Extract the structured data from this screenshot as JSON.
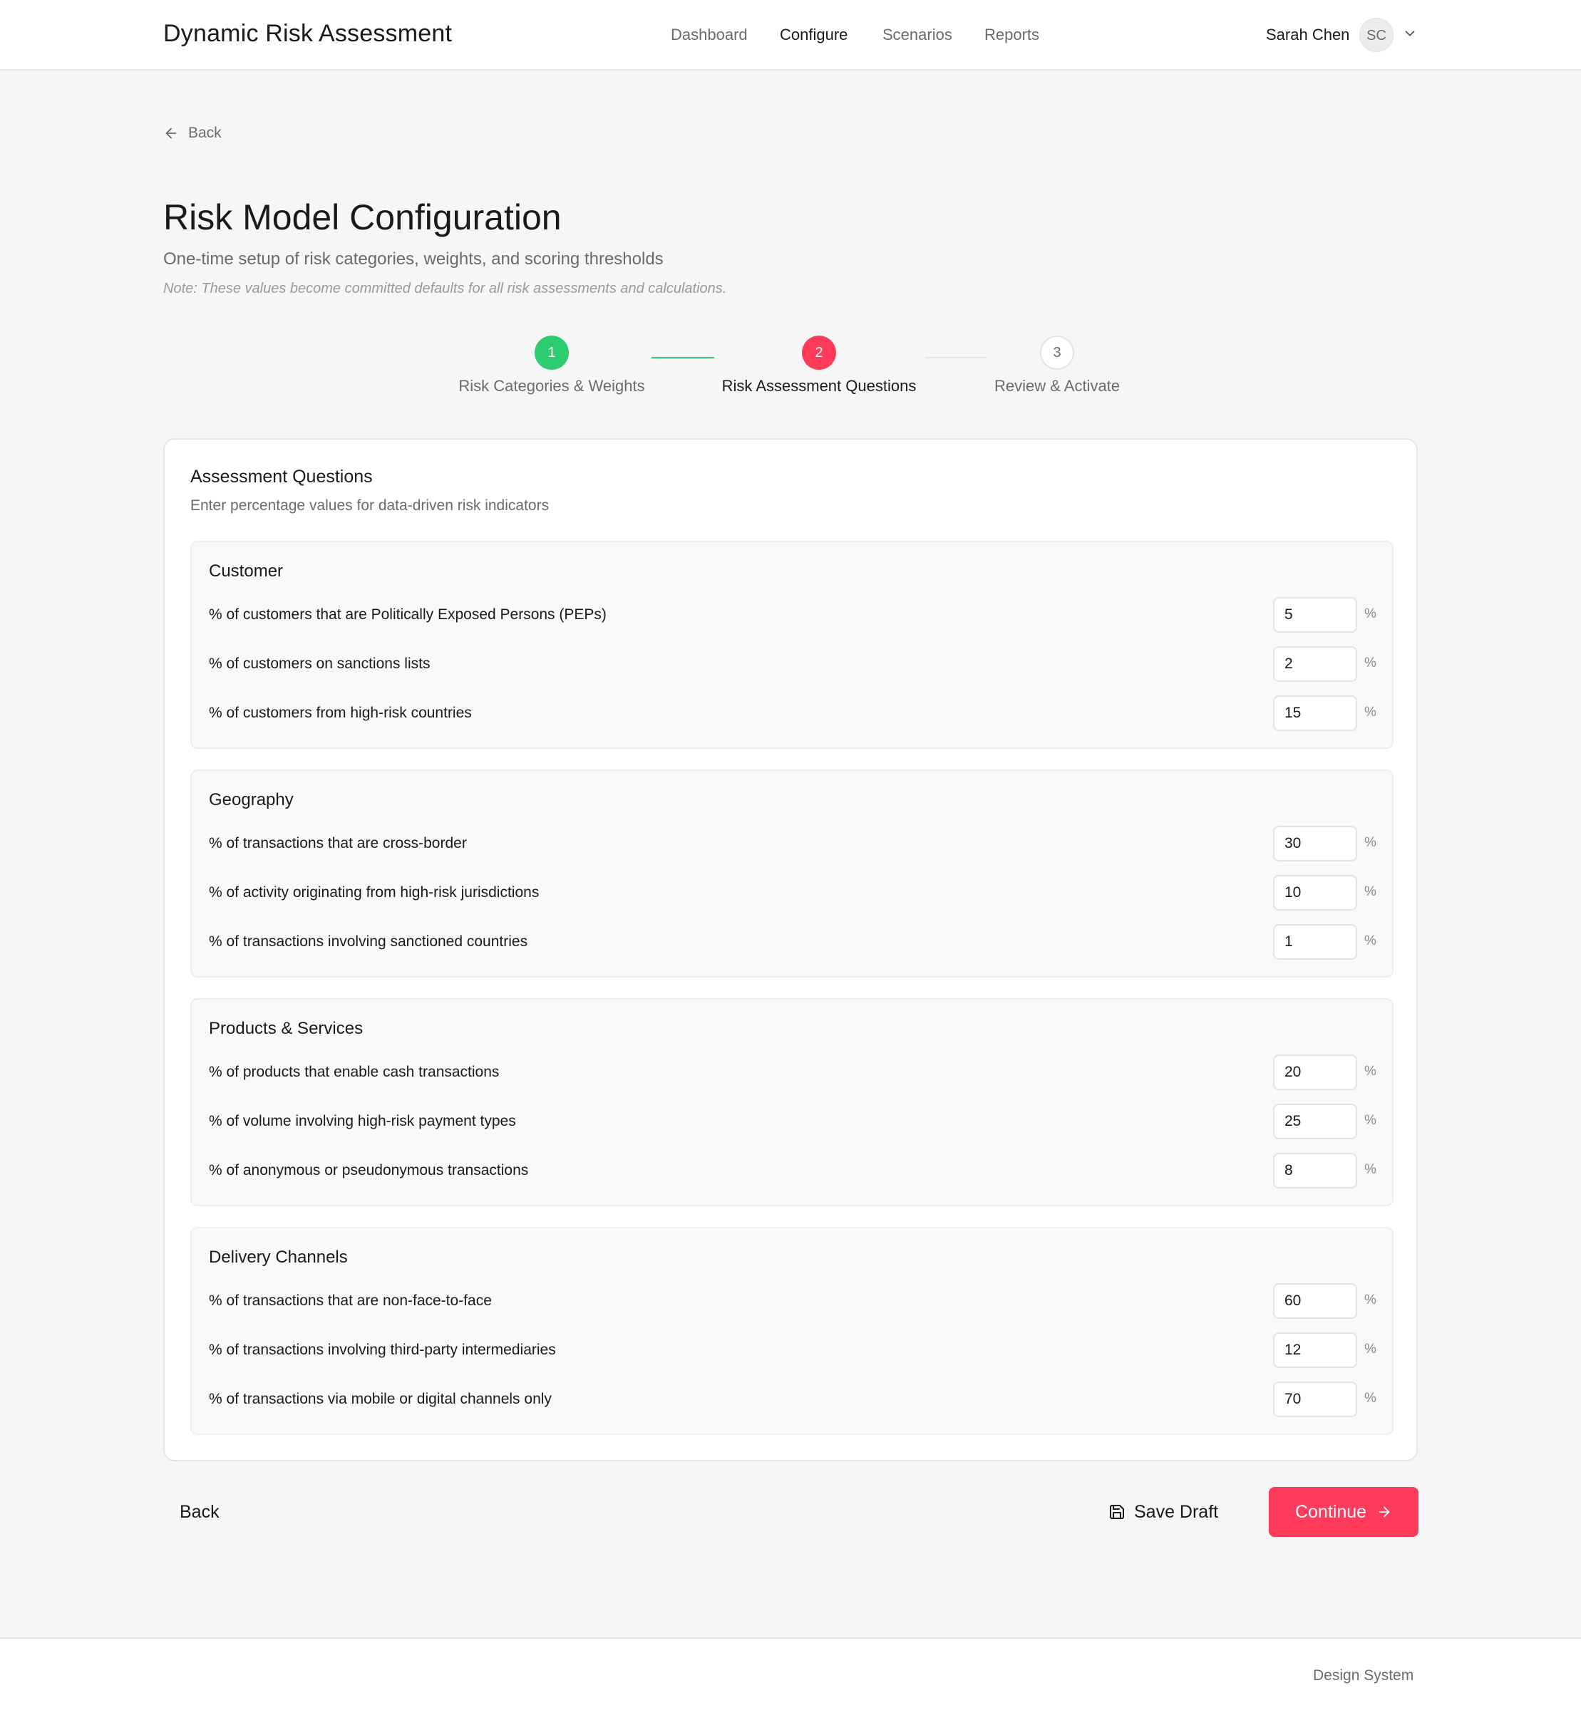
{
  "header": {
    "app_title": "Dynamic Risk Assessment",
    "nav": [
      {
        "label": "Dashboard",
        "active": false
      },
      {
        "label": "Configure",
        "active": true
      },
      {
        "label": "Scenarios",
        "active": false
      },
      {
        "label": "Reports",
        "active": false
      }
    ],
    "user_name": "Sarah Chen",
    "avatar_initials": "SC"
  },
  "back_link": "Back",
  "page": {
    "title": "Risk Model Configuration",
    "subtitle": "One-time setup of risk categories, weights, and scoring thresholds",
    "note": "Note: These values become committed defaults for all risk assessments and calculations."
  },
  "stepper": {
    "steps": [
      {
        "number": "1",
        "label": "Risk Categories & Weights",
        "state": "complete"
      },
      {
        "number": "2",
        "label": "Risk Assessment Questions",
        "state": "current"
      },
      {
        "number": "3",
        "label": "Review & Activate",
        "state": "upcoming"
      }
    ]
  },
  "card": {
    "title": "Assessment Questions",
    "subtitle": "Enter percentage values for data-driven risk indicators",
    "sections": [
      {
        "title": "Customer",
        "questions": [
          {
            "label": "% of customers that are Politically Exposed Persons (PEPs)",
            "value": "5",
            "unit": "%"
          },
          {
            "label": "% of customers on sanctions lists",
            "value": "2",
            "unit": "%"
          },
          {
            "label": "% of customers from high-risk countries",
            "value": "15",
            "unit": "%"
          }
        ]
      },
      {
        "title": "Geography",
        "questions": [
          {
            "label": "% of transactions that are cross-border",
            "value": "30",
            "unit": "%"
          },
          {
            "label": "% of activity originating from high-risk jurisdictions",
            "value": "10",
            "unit": "%"
          },
          {
            "label": "% of transactions involving sanctioned countries",
            "value": "1",
            "unit": "%"
          }
        ]
      },
      {
        "title": "Products & Services",
        "questions": [
          {
            "label": "% of products that enable cash transactions",
            "value": "20",
            "unit": "%"
          },
          {
            "label": "% of volume involving high-risk payment types",
            "value": "25",
            "unit": "%"
          },
          {
            "label": "% of anonymous or pseudonymous transactions",
            "value": "8",
            "unit": "%"
          }
        ]
      },
      {
        "title": "Delivery Channels",
        "questions": [
          {
            "label": "% of transactions that are non-face-to-face",
            "value": "60",
            "unit": "%"
          },
          {
            "label": "% of transactions involving third-party intermediaries",
            "value": "12",
            "unit": "%"
          },
          {
            "label": "% of transactions via mobile or digital channels only",
            "value": "70",
            "unit": "%"
          }
        ]
      }
    ]
  },
  "actions": {
    "back_label": "Back",
    "save_label": "Save Draft",
    "continue_label": "Continue"
  },
  "footer": {
    "text": "Design System"
  },
  "colors": {
    "accent": "#ff3b5c",
    "complete": "#2ecc71",
    "page_bg": "#f6f6f6"
  },
  "icons": {
    "back": "arrow-left-icon",
    "user_menu": "chevron-down-icon",
    "save": "save-icon",
    "continue": "arrow-right-icon"
  }
}
